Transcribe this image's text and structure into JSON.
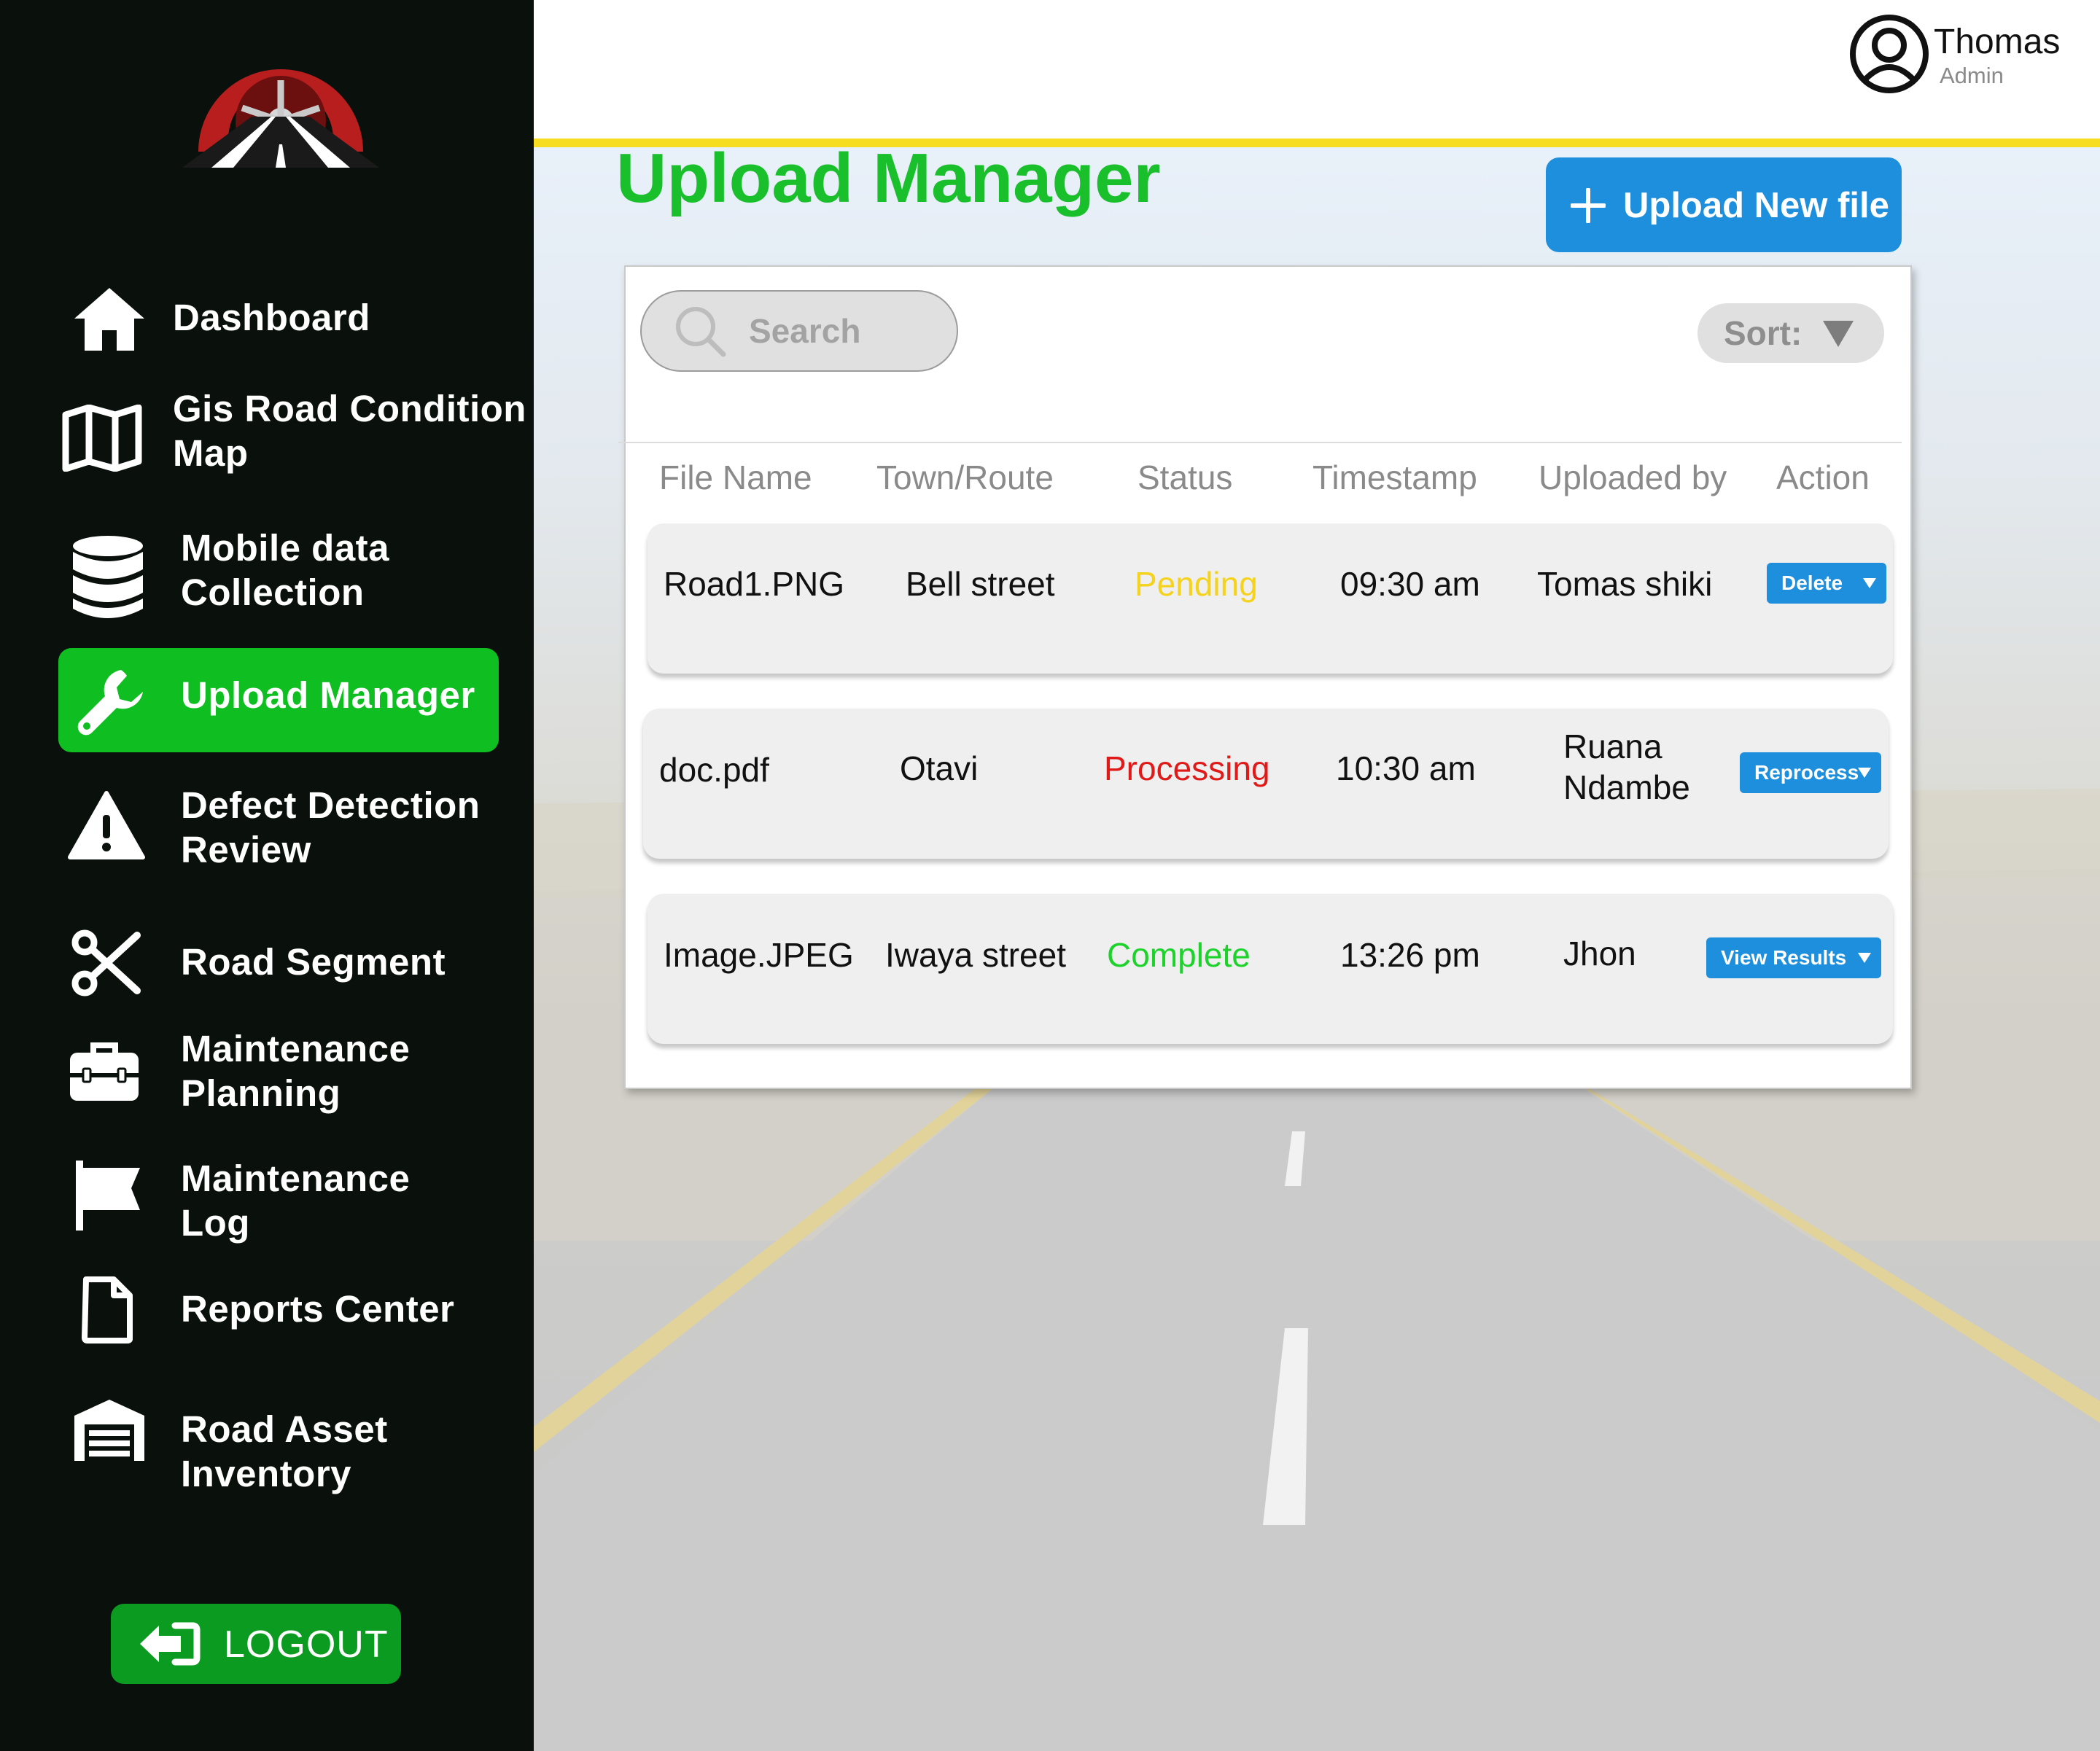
{
  "sidebar": {
    "items": [
      {
        "label": "Dashboard",
        "icon": "home-icon"
      },
      {
        "label": "Gis Road Condition\nMap",
        "icon": "map-icon"
      },
      {
        "label": "Mobile data\nCollection",
        "icon": "database-icon"
      },
      {
        "label": "Upload Manager",
        "icon": "wrench-icon",
        "active": true
      },
      {
        "label": "Defect Detection\nReview",
        "icon": "warning-icon"
      },
      {
        "label": "Road Segment",
        "icon": "scissors-icon"
      },
      {
        "label": "Maintenance\nPlanning",
        "icon": "toolbox-icon"
      },
      {
        "label": "Maintenance\nLog",
        "icon": "flag-icon"
      },
      {
        "label": "Reports Center",
        "icon": "document-icon"
      },
      {
        "label": "Road Asset\nInventory",
        "icon": "warehouse-icon"
      }
    ],
    "logout_label": "LOGOUT"
  },
  "user": {
    "name": "Thomas",
    "role": "Admin"
  },
  "main": {
    "title": "Upload Manager",
    "upload_button_label": "Upload New file",
    "search_placeholder": "Search",
    "sort_label": "Sort:",
    "columns": [
      "File Name",
      "Town/Route",
      "Status",
      "Timestamp",
      "Uploaded by",
      "Action"
    ],
    "rows": [
      {
        "file": "Road1.PNG",
        "town": "Bell street",
        "status": "Pending",
        "status_color": "#f5d21b",
        "time": "09:30 am",
        "by": "Tomas shiki",
        "action": "Delete"
      },
      {
        "file": "doc.pdf",
        "town": "Otavi",
        "status": "Processing",
        "status_color": "#e01919",
        "time": "10:30 am",
        "by": "Ruana\nNdambe",
        "action": "Reprocess"
      },
      {
        "file": "Image.JPEG",
        "town": "Iwaya street",
        "status": "Complete",
        "status_color": "#1ed22c",
        "time": "13:26 pm",
        "by": "Jhon",
        "action": "View Results"
      }
    ]
  },
  "colors": {
    "sidebar_bg": "#0a110c",
    "active": "#0fbf22",
    "accent_blue": "#1e8fdc",
    "title_green": "#19c02c",
    "topbar_line": "#f6dd1f"
  }
}
